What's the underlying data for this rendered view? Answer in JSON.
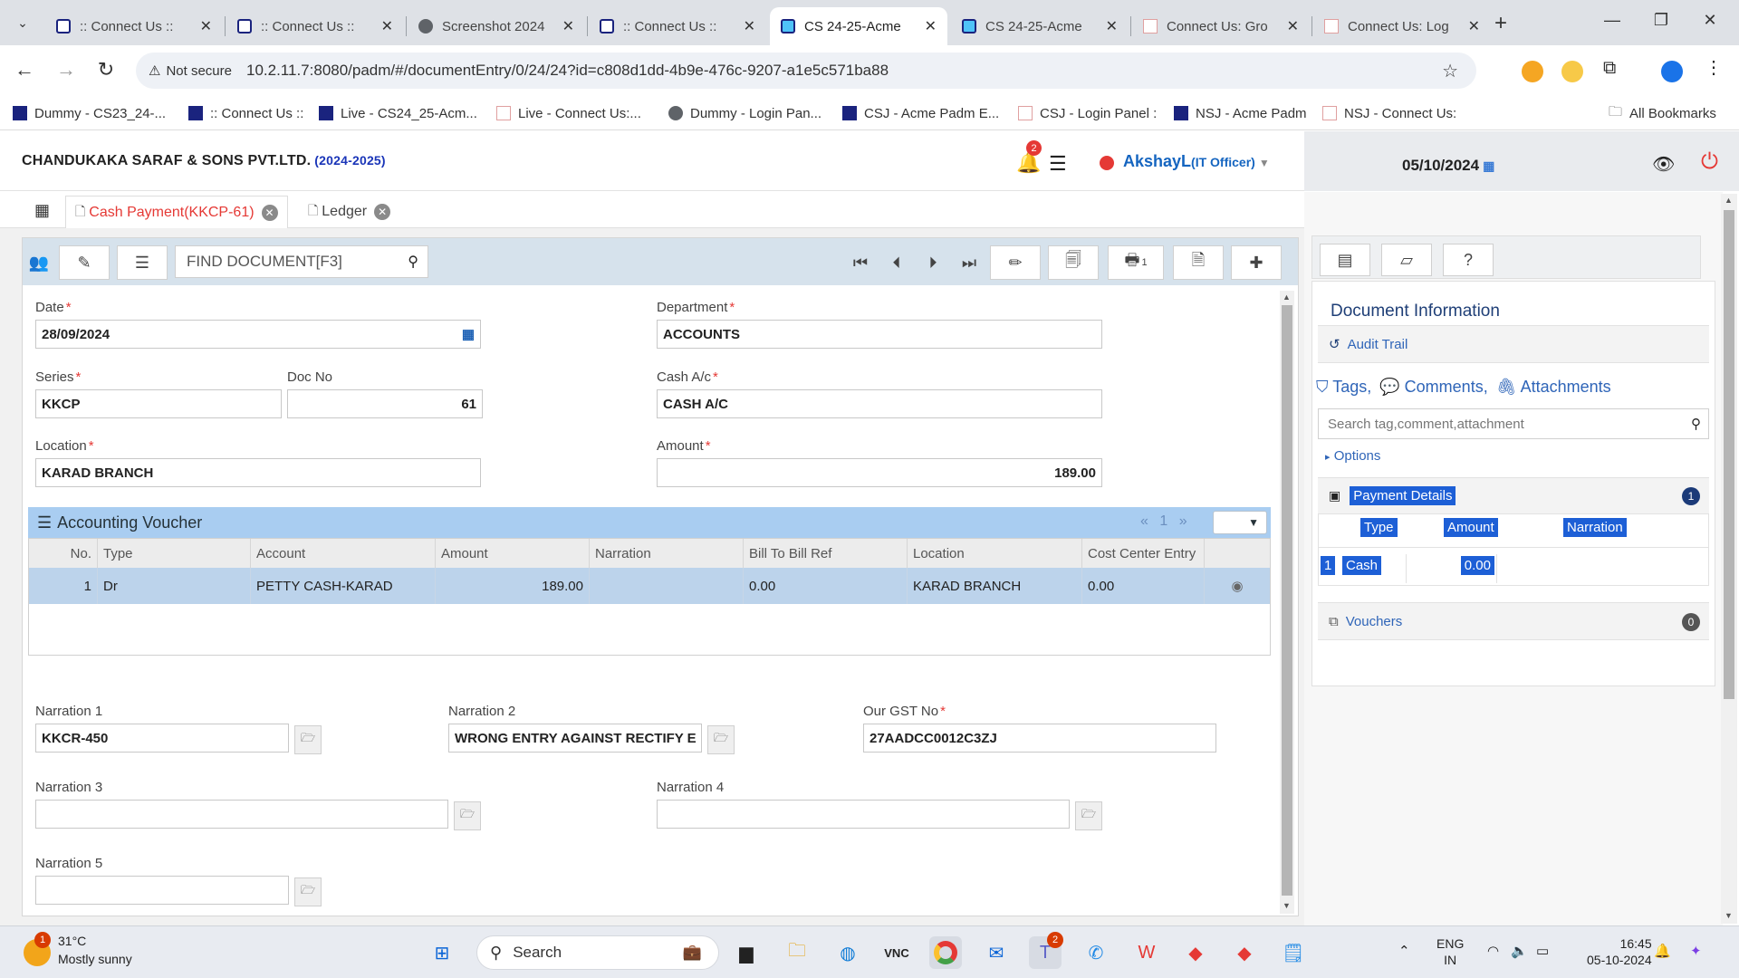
{
  "browser": {
    "tabs": [
      {
        "title": ":: Connect Us ::",
        "active": false
      },
      {
        "title": ":: Connect Us ::",
        "active": false
      },
      {
        "title": "Screenshot 2024",
        "active": false
      },
      {
        "title": ":: Connect Us ::",
        "active": false
      },
      {
        "title": "CS 24-25-Acme",
        "active": true
      },
      {
        "title": "CS 24-25-Acme",
        "active": false
      },
      {
        "title": "Connect Us: Gro",
        "active": false
      },
      {
        "title": "Connect Us: Log",
        "active": false
      }
    ],
    "security_label": "Not secure",
    "url": "10.2.11.7:8080/padm/#/documentEntry/0/24/24?id=c808d1dd-4b9e-476c-9207-a1e5c571ba88",
    "bookmarks": [
      "Dummy - CS23_24-...",
      ":: Connect Us ::",
      "Live - CS24_25-Acm...",
      "Live - Connect Us:...",
      "Dummy - Login Pan...",
      "CSJ - Acme Padm E...",
      "CSJ - Login Panel :",
      "NSJ - Acme Padm",
      "NSJ - Connect Us:"
    ],
    "all_bookmarks": "All Bookmarks"
  },
  "header": {
    "company": "CHANDUKAKA SARAF & SONS PVT.LTD.",
    "year": "(2024-2025)",
    "notification_count": "2",
    "user_name": "AkshayL",
    "user_role": "(IT Officer)",
    "date": "05/10/2024"
  },
  "app_tabs": [
    {
      "label": "Cash Payment(KKCP-61)",
      "active": true
    },
    {
      "label": "Ledger",
      "active": false
    }
  ],
  "toolbar": {
    "find_placeholder": "FIND DOCUMENT[F3]",
    "print_badge": "1"
  },
  "form": {
    "date_label": "Date",
    "date_value": "28/09/2024",
    "department_label": "Department",
    "department_value": "ACCOUNTS",
    "series_label": "Series",
    "series_value": "KKCP",
    "docno_label": "Doc No",
    "docno_value": "61",
    "cash_ac_label": "Cash A/c",
    "cash_ac_value": "CASH A/C",
    "location_label": "Location",
    "location_value": "KARAD BRANCH",
    "amount_label": "Amount",
    "amount_value": "189.00",
    "narration1_label": "Narration 1",
    "narration1_value": "KKCR-450",
    "narration2_label": "Narration 2",
    "narration2_value": "WRONG ENTRY AGAINST RECTIFY E",
    "gst_label": "Our GST No",
    "gst_value": "27AADCC0012C3ZJ",
    "narration3_label": "Narration 3",
    "narration3_value": "",
    "narration4_label": "Narration 4",
    "narration4_value": "",
    "narration5_label": "Narration 5",
    "narration5_value": ""
  },
  "voucher": {
    "title": "Accounting Voucher",
    "page_prev": "«",
    "page_num": "1",
    "page_next": "»",
    "columns": [
      "No.",
      "Type",
      "Account",
      "Amount",
      "Narration",
      "Bill To Bill Ref",
      "Location",
      "Cost Center Entry"
    ],
    "rows": [
      {
        "no": "1",
        "type": "Dr",
        "account": "PETTY CASH-KARAD",
        "amount": "189.00",
        "narration": "",
        "bill_ref": "0.00",
        "location": "KARAD BRANCH",
        "cost_center": "0.00"
      }
    ]
  },
  "right_panel": {
    "title": "Document Information",
    "audit_trail": "Audit Trail",
    "tags": "Tags,",
    "comments": "Comments,",
    "attachments": "Attachments",
    "search_placeholder": "Search tag,comment,attachment",
    "options": "Options",
    "payment_details": "Payment Details",
    "payment_count": "1",
    "payment_columns": [
      "Type",
      "Amount",
      "Narration"
    ],
    "payment_rows": [
      {
        "no": "1",
        "type": "Cash",
        "amount": "0.00",
        "narration": ""
      }
    ],
    "vouchers": "Vouchers",
    "vouchers_count": "0"
  },
  "taskbar": {
    "weather_badge": "1",
    "temperature": "31°C",
    "condition": "Mostly sunny",
    "search_label": "Search",
    "teams_badge": "2",
    "lang1": "ENG",
    "lang2": "IN",
    "time": "16:45",
    "date": "05-10-2024"
  }
}
